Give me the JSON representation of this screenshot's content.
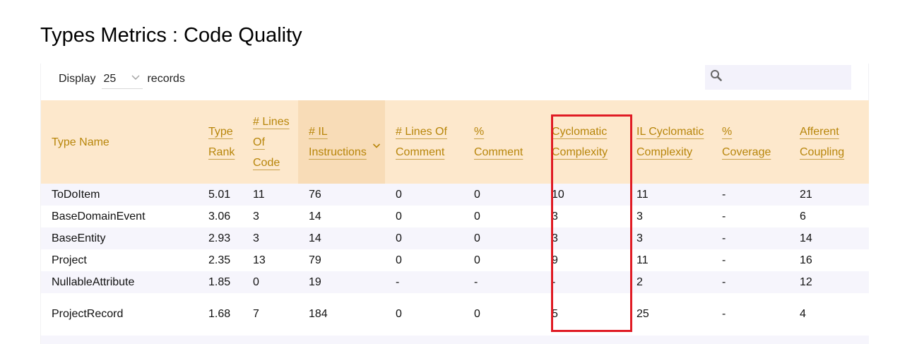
{
  "page_title": "Types Metrics : Code Quality",
  "length_control": {
    "prefix": "Display",
    "value": "25",
    "suffix": "records"
  },
  "search": {
    "placeholder": ""
  },
  "table": {
    "columns": [
      {
        "label": "Type Name",
        "link": false,
        "sorted": false
      },
      {
        "label": "Type Rank",
        "link": true,
        "sorted": false
      },
      {
        "label": "# Lines Of Code",
        "link": true,
        "sorted": false
      },
      {
        "label": "# IL Instructions",
        "link": true,
        "sorted": true
      },
      {
        "label": "# Lines Of Comment",
        "link": true,
        "sorted": false
      },
      {
        "label": "% Comment",
        "link": true,
        "sorted": false
      },
      {
        "label": "Cyclomatic Complexity",
        "link": true,
        "sorted": false
      },
      {
        "label": "IL Cyclomatic Complexity",
        "link": true,
        "sorted": false
      },
      {
        "label": "% Coverage",
        "link": true,
        "sorted": false
      },
      {
        "label": "Afferent Coupling",
        "link": true,
        "sorted": false
      }
    ],
    "rows": [
      [
        "ToDoItem",
        "5.01",
        "11",
        "76",
        "0",
        "0",
        "10",
        "11",
        "-",
        "21"
      ],
      [
        "BaseDomainEvent",
        "3.06",
        "3",
        "14",
        "0",
        "0",
        "3",
        "3",
        "-",
        "6"
      ],
      [
        "BaseEntity",
        "2.93",
        "3",
        "14",
        "0",
        "0",
        "3",
        "3",
        "-",
        "14"
      ],
      [
        "Project",
        "2.35",
        "13",
        "79",
        "0",
        "0",
        "9",
        "11",
        "-",
        "16"
      ],
      [
        "NullableAttribute",
        "1.85",
        "0",
        "19",
        "-",
        "-",
        "-",
        "2",
        "-",
        "12"
      ],
      [
        "ProjectRecord",
        "1.68",
        "7",
        "184",
        "0",
        "0",
        "5",
        "25",
        "-",
        "4"
      ]
    ]
  },
  "colors": {
    "header_bg": "#fde8cc",
    "header_text": "#b8860b",
    "row_alt": "#f6f5fc",
    "highlight": "#e01b24"
  },
  "icons": {
    "search": "search-icon",
    "dropdown": "chevron-down-icon",
    "sort": "chevron-down-icon"
  }
}
